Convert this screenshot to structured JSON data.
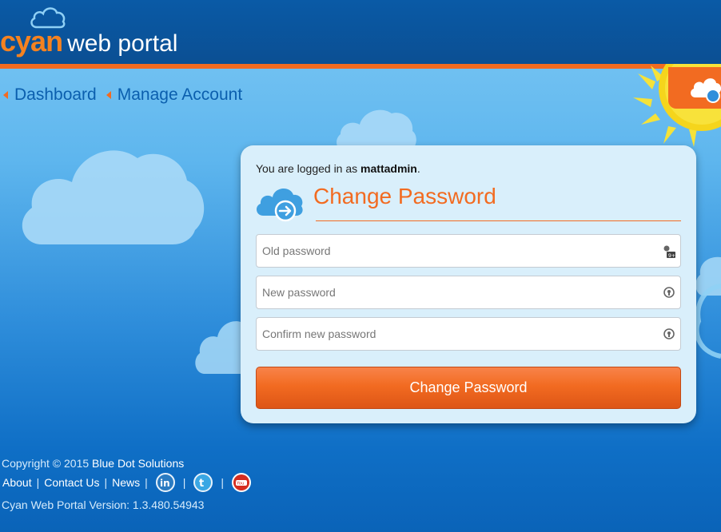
{
  "header": {
    "brand": "cyan",
    "product": "web portal"
  },
  "breadcrumb": [
    {
      "label": "Dashboard"
    },
    {
      "label": "Manage Account"
    }
  ],
  "card": {
    "logged_in_prefix": "You are logged in as",
    "username": "mattadmin",
    "logged_in_suffix": ".",
    "title": "Change Password",
    "fields": [
      {
        "placeholder": "Old password",
        "value": ""
      },
      {
        "placeholder": "New password",
        "value": ""
      },
      {
        "placeholder": "Confirm new password",
        "value": ""
      }
    ],
    "submit_label": "Change Password"
  },
  "footer": {
    "copyright": "Copyright © 2015",
    "company": "Blue Dot Solutions",
    "links": {
      "about": "About",
      "contact": "Contact Us",
      "news": "News",
      "separator": "|"
    },
    "social": [
      "linkedin-icon",
      "twitter-icon",
      "youtube-icon"
    ],
    "version": "Cyan Web Portal Version: 1.3.480.54943"
  },
  "colors": {
    "accent": "#f26b21",
    "header": "#0b4f93",
    "link": "#0b5fae",
    "card": "#d9effb"
  }
}
